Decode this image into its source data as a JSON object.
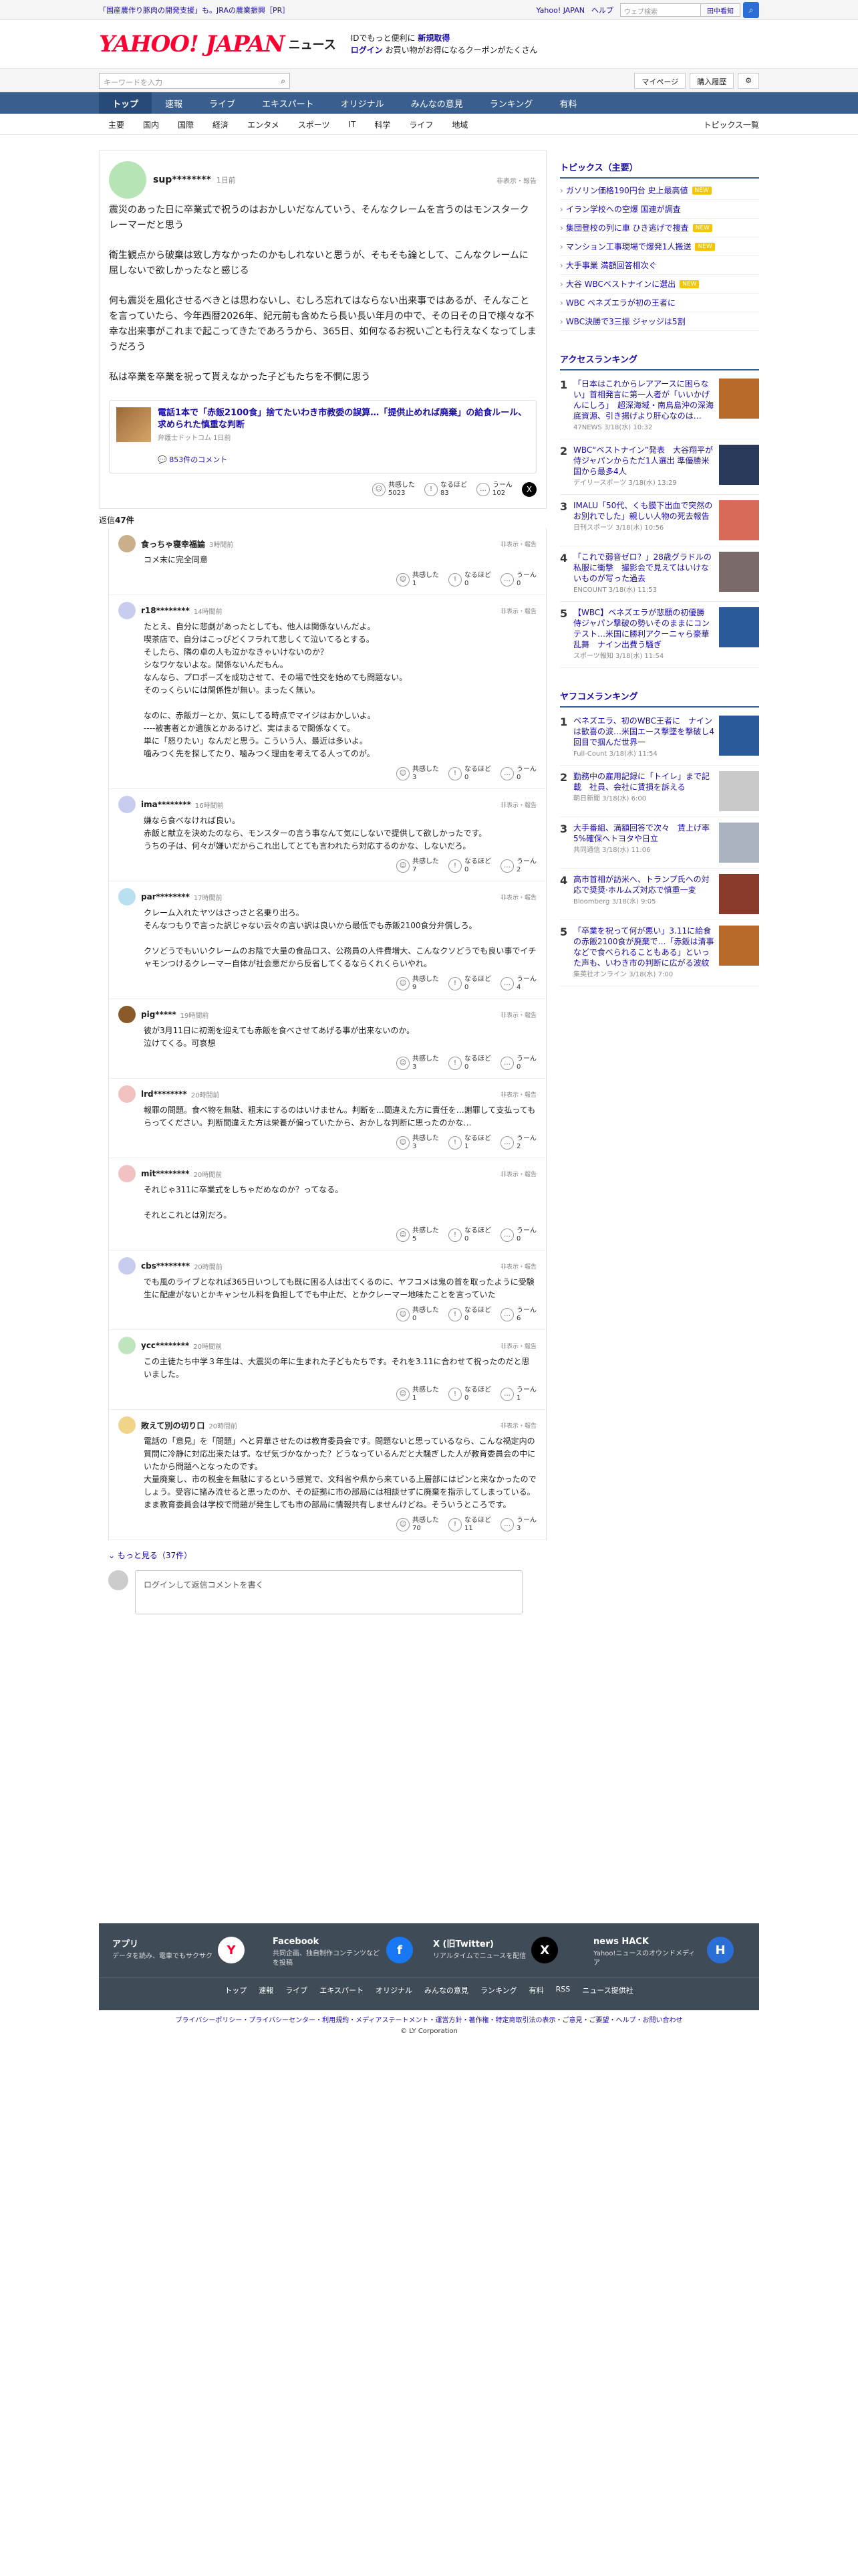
{
  "topbar": {
    "ad": "「国産農作り豚肉の開発支援」も。JRAの農業振興［PR］",
    "links": [
      "Yahoo! JAPAN",
      "ヘルプ"
    ],
    "search_placeholder": "ウェブ検索",
    "detail_label": "田中看知"
  },
  "header": {
    "logo": "YAHOO! JAPAN",
    "logo_sub": "ニュース",
    "promo_line1": "IDでもっと便利に",
    "promo_link1": "新規取得",
    "promo_line2": "ログイン",
    "promo_line3": "お買い物がお得になるクーポンがたくさん"
  },
  "searchbar": {
    "placeholder": "キーワードを入力",
    "mypage": "マイページ",
    "history": "購入履歴"
  },
  "nav": [
    "トップ",
    "速報",
    "ライブ",
    "エキスパート",
    "オリジナル",
    "みんなの意見",
    "ランキング",
    "有料"
  ],
  "subnav": [
    "主要",
    "国内",
    "国際",
    "経済",
    "エンタメ",
    "スポーツ",
    "IT",
    "科学",
    "ライフ",
    "地域"
  ],
  "subnav_right": "トピックス一覧",
  "main_comment": {
    "author": "sup********",
    "time": "1日前",
    "report": "非表示・報告",
    "paragraphs": [
      "震災のあった日に卒業式で祝うのはおかしいだなんていう、そんなクレームを言うのはモンスタークレーマーだと思う",
      "衛生観点から破棄は致し方なかったのかもしれないと思うが、そもそも論として、こんなクレームに屈しないで欲しかったなと感じる",
      "何も震災を風化させるべきとは思わないし、むしろ忘れてはならない出来事ではあるが、そんなことを言っていたら、今年西暦2026年、紀元前も含めたら長い長い年月の中で、その日その日で様々な不幸な出来事がこれまで起こってきたであろうから、365日、如何なるお祝いごとも行えなくなってしまうだろう",
      "私は卒業を卒業を祝って貰えなかった子どもたちを不憫に思う"
    ],
    "article": {
      "title": "電話1本で「赤飯2100食」捨てたいわき市教委の誤算…「提供止めれば廃棄」の給食ルール、求められた慎重な判断",
      "source": "弁護士ドットコム 1日前",
      "comments": "853件のコメント"
    },
    "reactions": {
      "agree_label": "共感した",
      "agree": "5023",
      "learn_label": "なるほど",
      "learn": "83",
      "hmm_label": "うーん",
      "hmm": "102"
    }
  },
  "reply_count_label": "返信",
  "reply_count": "47件",
  "replies": [
    {
      "name": "食っちゃ寝幸福論",
      "time": "3時間前",
      "text": [
        "コメ末に完全同意"
      ],
      "agree": "1",
      "learn": "0",
      "hmm": "0",
      "av": "#c9b08a"
    },
    {
      "name": "r18********",
      "time": "14時間前",
      "text": [
        "たとえ、自分に悲劇があったとしても、他人は関係ないんだよ。\n喫茶店で、自分はこっぴどくフラれて悲しくて泣いてるとする。\nそしたら、隣の卓の人も泣かなきゃいけないのか？\nシなワケないよな。関係ないんだもん。\nなんなら、プロポーズを成功させて、その場で性交を始めても問題ない。\nそのっくらいには関係性が無い。まったく無い。",
        "なのに、赤飯ガーとか、気にしてる時点でマイジはおかしいよ。\n----被害者とか遺族とかあるけど、実はまるで関係なくて。\n単に「怒りたい」なんだと思う。こういう人、最近は多いよ。\n噛みつく先を探してたり、噛みつく理由を考えてる人ってのが。"
      ],
      "agree": "3",
      "learn": "0",
      "hmm": "0",
      "av": "#c8cdf0"
    },
    {
      "name": "ima********",
      "time": "16時間前",
      "text": [
        "嫌なら食べなければ良い。\n赤飯と献立を決めたのなら、モンスターの言う事なんて気にしないで提供して欲しかったです。\nうちの子は、何々が嫌いだからこれ出してとても言われたら対応するのかな、しないだろ。"
      ],
      "agree": "7",
      "learn": "0",
      "hmm": "2",
      "av": "#c8cdf0"
    },
    {
      "name": "par********",
      "time": "17時間前",
      "text": [
        "クレーム入れたヤツはさっさと名乗り出ろ。\nそんなつもりで言った訳じゃない云々の言い訳は良いから最低でも赤飯2100食分弁償しろ。",
        "クソどうでもいいクレームのお陰で大量の食品ロス、公務員の人件費増大、こんなクソどうでも良い事でイチャモンつけるクレーマー自体が社会悪だから反省してくるならくれくらいやれ。"
      ],
      "agree": "9",
      "learn": "0",
      "hmm": "4",
      "av": "#b9e0ef"
    },
    {
      "name": "pig*****",
      "time": "19時間前",
      "text": [
        "彼が3月11日に初潮を迎えても赤飯を食べさせてあげる事が出来ないのか。\n泣けてくる。可哀想"
      ],
      "agree": "3",
      "learn": "0",
      "hmm": "0",
      "av": "#8a5a2a"
    },
    {
      "name": "lrd********",
      "time": "20時間前",
      "text": [
        "報罪の問題。食べ物を無駄、粗末にするのはいけません。判断を…間違えた方に責任を…謝罪して支払ってもらってください。判断間違えた方は栄養が偏っていたから、おかしな判断に思ったのかな…"
      ],
      "agree": "3",
      "learn": "1",
      "hmm": "2",
      "av": "#f2c2c2"
    },
    {
      "name": "mit********",
      "time": "20時間前",
      "text": [
        "それじゃ311に卒業式をしちゃだめなのか？ってなる。",
        "それとこれとは別だろ。"
      ],
      "agree": "5",
      "learn": "0",
      "hmm": "0",
      "av": "#f2c2c2"
    },
    {
      "name": "cbs********",
      "time": "20時間前",
      "text": [
        "でも風のライブとなれば365日いつしても既に困る人は出てくるのに、ヤフコメは鬼の首を取ったように受験生に配慮がないとかキャンセル料を負担してでも中止だ、とかクレーマー地味たことを言っていた"
      ],
      "agree": "0",
      "learn": "0",
      "hmm": "6",
      "av": "#c8cdf0"
    },
    {
      "name": "ycc********",
      "time": "20時間前",
      "text": [
        "この主徒たち中学３年生は、大震災の年に生まれた子どもたちです。それを3.11に合わせて祝ったのだと思いました。"
      ],
      "agree": "1",
      "learn": "0",
      "hmm": "1",
      "av": "#bfe5bf"
    },
    {
      "name": "敗えて別の切り口",
      "time": "20時間前",
      "text": [
        "電話の「意見」を「問題」へと昇華させたのは教育委員会です。問題ないと思っているなら、こんな禍定内の質問に冷静に対応出来たはず。なぜ気づかなかった？どうなっているんだと大騒ぎした人が教育委員会の中にいたから問題へとなったのです。\n大量廃棄し、市の税金を無駄にするという感覚で、文科省や県から来ている上層部にはピンと来なかったのでしょう。受容に諸み流せると思ったのか、その証拠に市の部局には相談せずに廃棄を指示してしまっている。\nまま教育委員会は学校で問題が発生しても市の部局に情報共有しませんけどね。そういうところです。"
      ],
      "agree": "70",
      "learn": "11",
      "hmm": "3",
      "av": "#f0d48a"
    }
  ],
  "more_label": "もっと見る（37件）",
  "write_placeholder": "ログインして返信コメントを書く",
  "topics": {
    "title": "トピックス（主要）",
    "items": [
      {
        "text": "ガソリン価格190円台 史上最高値",
        "badge": "NEW"
      },
      {
        "text": "イラン学校への空爆 国連が調査",
        "badge": ""
      },
      {
        "text": "集団登校の列に車 ひき逃げで捜査",
        "badge": "NEW"
      },
      {
        "text": "マンション工事現場で爆発1人搬送",
        "badge": "NEW"
      },
      {
        "text": "大手事業 満額回答相次ぐ",
        "badge": ""
      },
      {
        "text": "大谷 WBCベストナインに選出",
        "badge": "NEW"
      },
      {
        "text": "WBC ベネズエラが初の王者に",
        "badge": ""
      },
      {
        "text": "WBC決勝で3三振 ジャッジは5割",
        "badge": ""
      }
    ]
  },
  "access_ranking": {
    "title": "アクセスランキング",
    "items": [
      {
        "no": "1",
        "text": "「日本はこれからレアアースに困らない」首相発言に第一人者が「いいかげんにしろ」　超深海域・南鳥島沖の深海底資源、引き揚げより肝心なのは…",
        "src": "47NEWS 3/18(水) 10:32",
        "c": "#b86a2a"
      },
      {
        "no": "2",
        "text": "WBC“ベストナイン”発表　大谷翔平が侍ジャパンからただ1人選出 準優勝米国から最多4人",
        "src": "デイリースポーツ 3/18(水) 13:29",
        "c": "#2a3a5a"
      },
      {
        "no": "3",
        "text": "IMALU「50代、くも膜下出血で突然のお別れでした」親しい人物の死去報告",
        "src": "日刊スポーツ 3/18(水) 10:56",
        "c": "#d86a5a"
      },
      {
        "no": "4",
        "text": "「これで弱音ゼロ？」28歳グラドルの私服に衝撃　撮影会で見えてはいけないものが写った過去",
        "src": "ENCOUNT 3/18(水) 11:53",
        "c": "#7a6a6a"
      },
      {
        "no": "5",
        "text": "【WBC】ベネズエラが悲願の初優勝　侍ジャパン撃破の勢いそのままにコンテスト…米国に勝利アクーニャら豪華乱舞　ナイン出費う騒ぎ",
        "src": "スポーツ報知 3/18(水) 11:54",
        "c": "#2a5a9a"
      }
    ]
  },
  "yahoo_ranking": {
    "title": "ヤフコメランキング",
    "items": [
      {
        "no": "1",
        "text": "ベネズエラ、初のWBC王者に　ナインは歓喜の涙…米国エース撃墜を撃破し4回目で掴んだ世界一",
        "src": "Full-Count 3/18(水) 11:54",
        "c": "#2a5a9a"
      },
      {
        "no": "2",
        "text": "勤務中の雇用記録に「トイレ」まで記載　社員、会社に賃損を訴える",
        "src": "朝日新聞 3/18(水) 6:00",
        "c": "#c9c9c9"
      },
      {
        "no": "3",
        "text": "大手番組、満額回答で次々　賃上げ率5%確保へトヨタや日立",
        "src": "共同通信 3/18(水) 11:06",
        "c": "#aab4c0"
      },
      {
        "no": "4",
        "text": "高市首相が訪米へ、トランプ氏への対応で奨奨·ホルムズ対応で慎重一変",
        "src": "Bloomberg 3/18(水) 9:05",
        "c": "#8a3a2a"
      },
      {
        "no": "5",
        "text": "「卒業を祝って何が悪い」3.11に給食の赤飯2100食が廃棄で…「赤飯は清事などで食べられることもある」といった声も、いわき市の判断に広がる波紋",
        "src": "集英社オンライン 3/18(水) 7:00",
        "c": "#b86a2a"
      }
    ]
  },
  "footer": {
    "apps": [
      {
        "title": "アプリ",
        "desc": "データを読み、電車でもサクサク",
        "icon": "Y"
      },
      {
        "title": "Facebook",
        "desc": "共同企画、独自制作コンテンツなどを投稿",
        "icon": "f"
      },
      {
        "title": "X (旧Twitter)",
        "desc": "リアルタイムでニュースを配信",
        "icon": "X"
      },
      {
        "title": "news HACK",
        "desc": "Yahoo!ニュースのオウンドメディア",
        "icon": "H"
      }
    ],
    "nav": [
      "トップ",
      "速報",
      "ライブ",
      "エキスパート",
      "オリジナル",
      "みんなの意見",
      "ランキング",
      "有料",
      "RSS",
      "ニュース提供社"
    ]
  },
  "legal": {
    "links": "プライバシーポリシー・プライバシーセンター・利用規約・メディアステートメント・運営方針・著作権・特定商取引法の表示・ご意見・ご要望・ヘルプ・お問い合わせ",
    "copyright": "© LY Corporation"
  }
}
